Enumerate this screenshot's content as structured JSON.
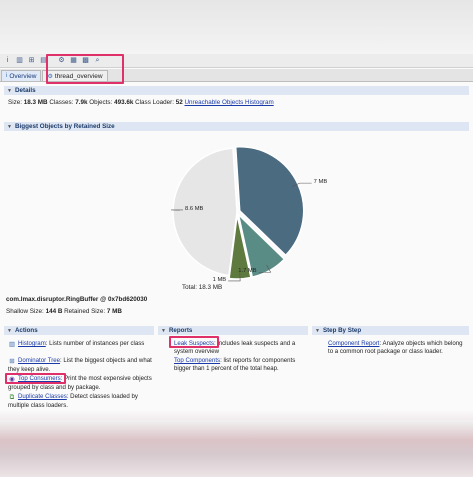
{
  "toolbar": {
    "icons": [
      "info-icon",
      "histogram-icon",
      "dominator-tree-icon",
      "oql-icon",
      "thread-overview-icon",
      "query-browser-icon",
      "find-object-icon",
      "search-icon"
    ]
  },
  "tabs": [
    {
      "label": "Overview"
    },
    {
      "label": "thread_overview"
    }
  ],
  "details": {
    "header": "Details",
    "size_label": "Size:",
    "size_value": "18.3 MB",
    "classes_label": "Classes:",
    "classes_value": "7.9k",
    "objects_label": "Objects:",
    "objects_value": "493.6k",
    "loader_label": "Class Loader:",
    "loader_value": "52",
    "histogram_link": "Unreachable Objects Histogram"
  },
  "biggest": {
    "header": "Biggest Objects by Retained Size",
    "total": "Total: 18.3 MB",
    "object_name": "com.lmax.disruptor.RingBuffer @ 0x7bd620030",
    "shallow_label": "Shallow Size:",
    "shallow_value": "144 B",
    "retained_label": "Retained Size:",
    "retained_value": "7 MB"
  },
  "chart_data": {
    "type": "pie",
    "title": "",
    "slices": [
      {
        "label": "7 MB",
        "value": 7,
        "color": "#4a6b80"
      },
      {
        "label": "1.7 MB",
        "value": 1.7,
        "color": "#5a8c86"
      },
      {
        "label": "1 MB",
        "value": 1,
        "color": "#5e7a3e"
      },
      {
        "label": "8.6 MB",
        "value": 8.6,
        "color": "#e6e6e6"
      }
    ]
  },
  "actions": {
    "header": "Actions",
    "items": [
      {
        "link": "Histogram",
        "text": ": Lists number of instances per class"
      },
      {
        "link": "Dominator Tree",
        "text": ": List the biggest objects and what they keep alive."
      },
      {
        "link": "Top Consumers",
        "text": ": Print the most expensive objects grouped by class and by package."
      },
      {
        "link": "Duplicate Classes",
        "text": ": Detect classes loaded by multiple class loaders."
      }
    ]
  },
  "reports": {
    "header": "Reports",
    "items": [
      {
        "link": "Leak Suspects",
        "text": ": includes leak suspects and a system overview"
      },
      {
        "link": "Top Components",
        "text": ": list reports for components bigger than 1 percent of the total heap."
      }
    ]
  },
  "step": {
    "header": "Step By Step",
    "items": [
      {
        "link": "Component Report",
        "text": ": Analyze objects which belong to a common root package or class loader."
      }
    ]
  }
}
